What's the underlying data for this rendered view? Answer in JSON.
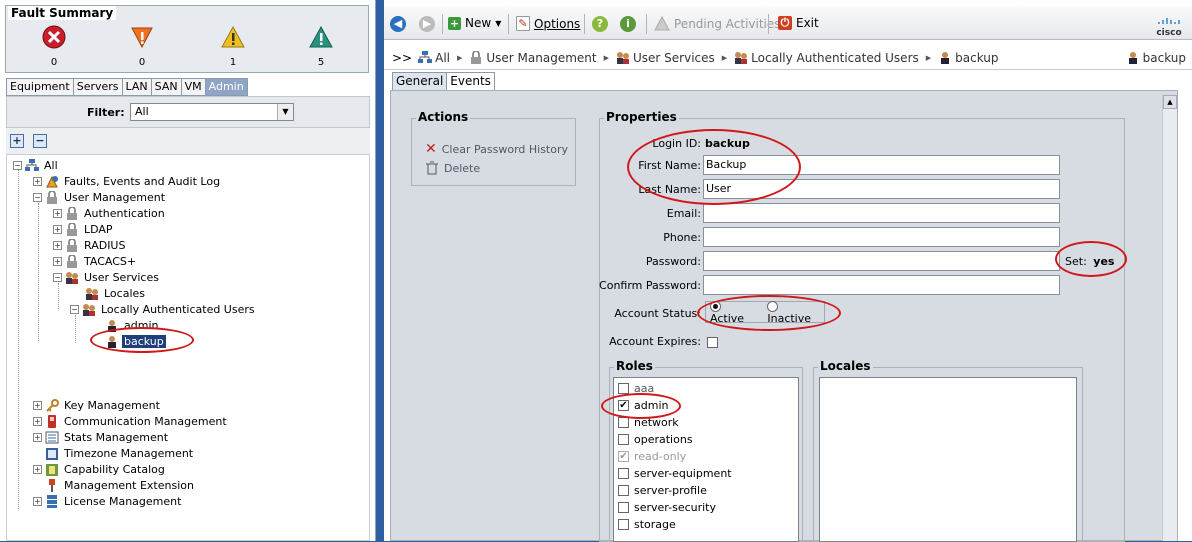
{
  "fault_summary": {
    "title": "Fault Summary",
    "items": [
      {
        "name": "critical",
        "count": "0",
        "color": "#c8202a"
      },
      {
        "name": "major",
        "count": "0",
        "color": "#f07020"
      },
      {
        "name": "minor",
        "count": "1",
        "color": "#f0c020"
      },
      {
        "name": "warning",
        "count": "5",
        "color": "#2a9080"
      }
    ]
  },
  "left_tabs": [
    "Equipment",
    "Servers",
    "LAN",
    "SAN",
    "VM",
    "Admin"
  ],
  "filter": {
    "label": "Filter:",
    "value": "All"
  },
  "tree": {
    "all": "All",
    "faults": "Faults, Events and Audit Log",
    "user_management": "User Management",
    "authentication": "Authentication",
    "ldap": "LDAP",
    "radius": "RADIUS",
    "tacacs": "TACACS+",
    "user_services": "User Services",
    "locales": "Locales",
    "local_users": "Locally Authenticated Users",
    "admin": "admin",
    "backup": "backup",
    "key_management": "Key Management",
    "communication_management": "Communication Management",
    "stats_management": "Stats Management",
    "timezone_management": "Timezone Management",
    "capability_catalog": "Capability Catalog",
    "management_extension": "Management Extension",
    "license_management": "License Management"
  },
  "toolbar": {
    "new": "New",
    "options": "Options",
    "pending": "Pending Activities",
    "exit": "Exit",
    "brand": "cisco"
  },
  "breadcrumb": {
    "prefix": ">>",
    "items": [
      "All",
      "User Management",
      "User Services",
      "Locally Authenticated Users",
      "backup"
    ],
    "current_user": "backup"
  },
  "content_tabs": [
    "General",
    "Events"
  ],
  "actions": {
    "title": "Actions",
    "clear_password_history": "Clear Password History",
    "delete": "Delete"
  },
  "properties": {
    "title": "Properties",
    "login_id_label": "Login ID:",
    "login_id": "backup",
    "first_name_label": "First Name:",
    "first_name": "Backup",
    "last_name_label": "Last Name:",
    "last_name": "User",
    "email_label": "Email:",
    "email": "",
    "phone_label": "Phone:",
    "phone": "",
    "password_label": "Password:",
    "password": "",
    "set_label": "Set:",
    "set_value": "yes",
    "confirm_password_label": "Confirm Password:",
    "confirm_password": "",
    "account_status_label": "Account Status:",
    "status_active": "Active",
    "status_inactive": "Inactive",
    "status_selected": "Active",
    "account_expires_label": "Account Expires:",
    "account_expires": false
  },
  "roles": {
    "title": "Roles",
    "items": [
      {
        "label": "aaa",
        "checked": false,
        "disabled": false
      },
      {
        "label": "admin",
        "checked": true,
        "disabled": false
      },
      {
        "label": "network",
        "checked": false,
        "disabled": false
      },
      {
        "label": "operations",
        "checked": false,
        "disabled": false
      },
      {
        "label": "read-only",
        "checked": true,
        "disabled": true
      },
      {
        "label": "server-equipment",
        "checked": false,
        "disabled": false
      },
      {
        "label": "server-profile",
        "checked": false,
        "disabled": false
      },
      {
        "label": "server-security",
        "checked": false,
        "disabled": false
      },
      {
        "label": "storage",
        "checked": false,
        "disabled": false
      }
    ]
  },
  "locales": {
    "title": "Locales",
    "items": []
  },
  "colors": {
    "highlight": "#d01818",
    "selection": "#1f3f7a",
    "frame": "#2f5fa0"
  }
}
